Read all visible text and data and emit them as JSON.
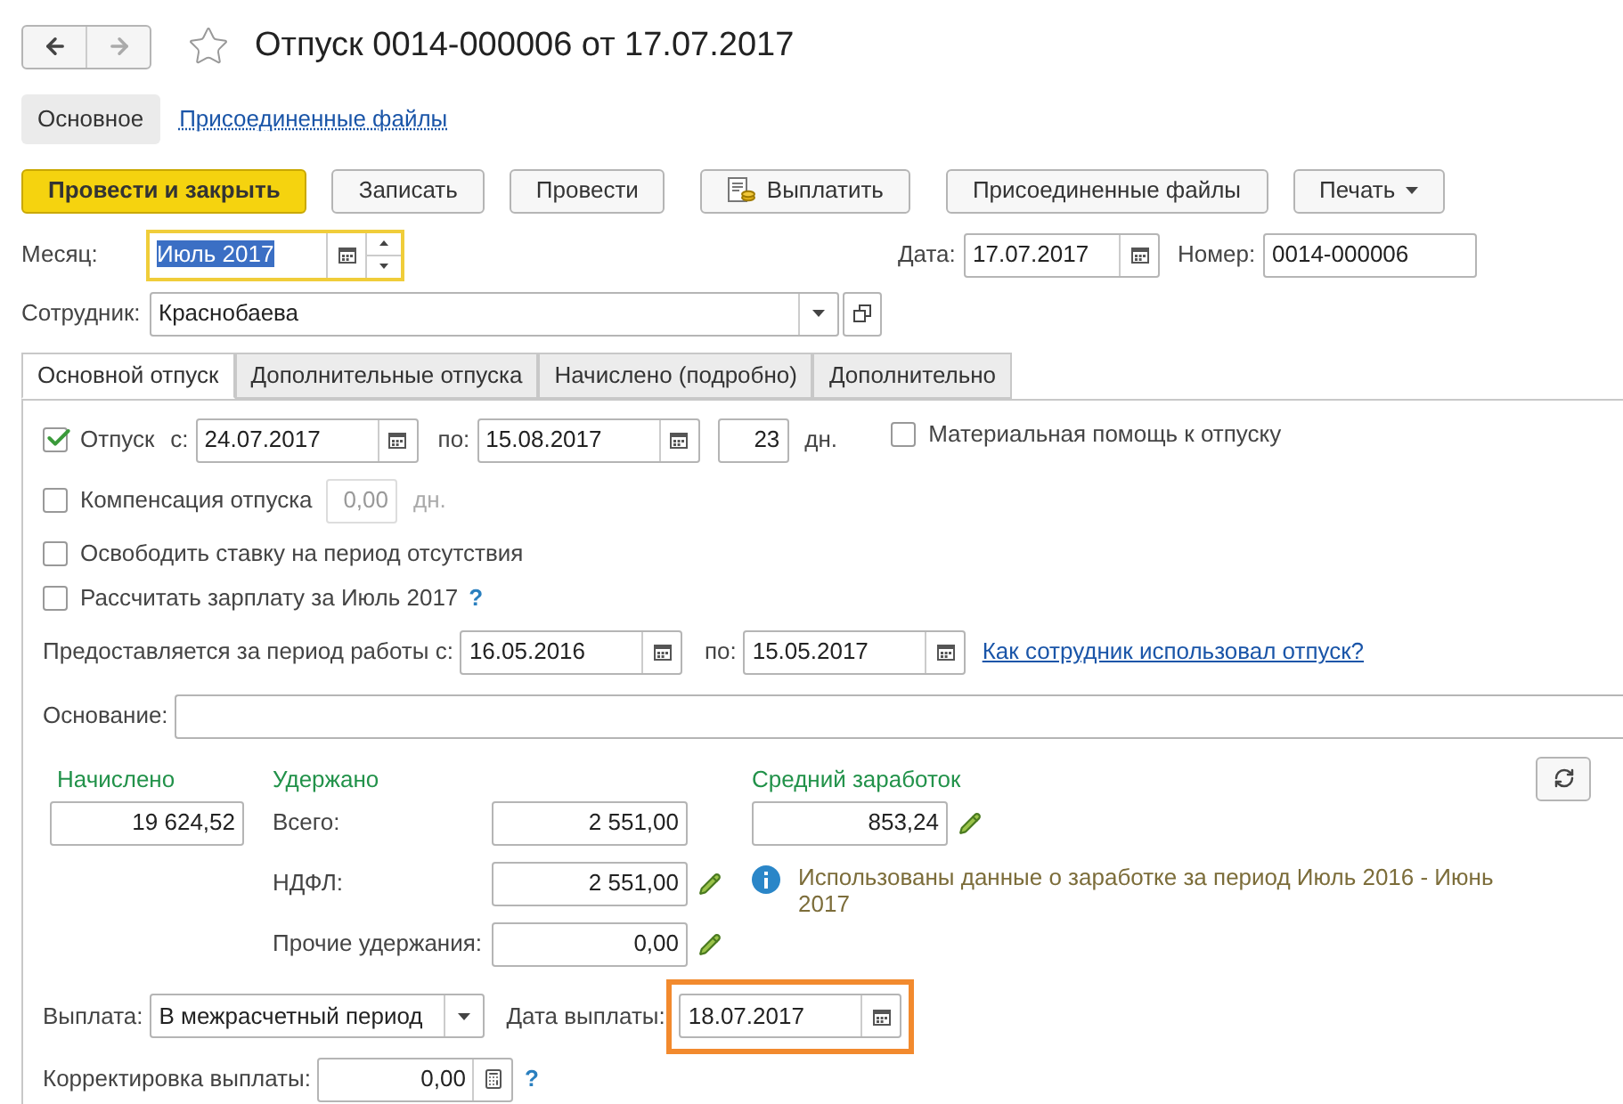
{
  "title": "Отпуск 0014-000006 от 17.07.2017",
  "sections": [
    {
      "label": "Основное",
      "selected": true
    },
    {
      "label": "Присоединенные файлы",
      "selected": false
    }
  ],
  "toolbar": [
    {
      "label": "Провести и закрыть",
      "kind": "primary"
    },
    {
      "label": "Записать",
      "kind": "plain"
    },
    {
      "label": "Провести",
      "kind": "plain"
    },
    {
      "label": "Выплатить",
      "kind": "icon"
    },
    {
      "label": "Присоединенные файлы",
      "kind": "plain"
    },
    {
      "label": "Печать",
      "kind": "menu"
    }
  ],
  "header": {
    "month": {
      "label": "Месяц:",
      "value": "Июль 2017",
      "focused": true
    },
    "date": {
      "label": "Дата:",
      "value": "17.07.2017"
    },
    "number": {
      "label": "Номер:",
      "value": "0014-000006"
    },
    "employee": {
      "label": "Сотрудник:",
      "value": "Краснобаева"
    }
  },
  "tabs": [
    {
      "label": "Основной отпуск",
      "selected": true
    },
    {
      "label": "Дополнительные отпуска",
      "selected": false
    },
    {
      "label": "Начислено (подробно)",
      "selected": false
    },
    {
      "label": "Дополнительно",
      "selected": false
    }
  ],
  "vacation": {
    "checked": true,
    "label": "Отпуск",
    "from_label": "с:",
    "from": "24.07.2017",
    "to_label": "по:",
    "to": "15.08.2017",
    "days": "23",
    "days_unit": "дн."
  },
  "material_aid": {
    "checked": false,
    "label": "Материальная помощь к отпуску"
  },
  "compensation": {
    "checked": false,
    "label": "Компенсация отпуска",
    "value": "0,00",
    "unit": "дн."
  },
  "free_rate": {
    "checked": false,
    "label": "Освободить ставку на период отсутствия"
  },
  "calc_salary": {
    "checked": false,
    "label": "Рассчитать зарплату за Июль 2017",
    "help": "?"
  },
  "work_period": {
    "label": "Предоставляется за период работы с:",
    "from": "16.05.2016",
    "to_label": "по:",
    "to": "15.05.2017",
    "link": "Как сотрудник использовал отпуск?"
  },
  "basis": {
    "label": "Основание:"
  },
  "accrued": {
    "heading": "Начислено",
    "value": "19 624,52"
  },
  "withheld": {
    "heading": "Удержано",
    "rows": [
      {
        "label": "Всего:",
        "value": "2 551,00",
        "editable": false
      },
      {
        "label": "НДФЛ:",
        "value": "2 551,00",
        "editable": true
      },
      {
        "label": "Прочие удержания:",
        "value": "0,00",
        "editable": true
      }
    ]
  },
  "average": {
    "heading": "Средний заработок",
    "value": "853,24",
    "editable": true,
    "note": "Использованы данные о заработке за период Июль 2016 - Июнь 2017"
  },
  "payment": {
    "label": "Выплата:",
    "value": "В межрасчетный период",
    "date_label": "Дата выплаты:",
    "date": "18.07.2017",
    "highlighted": true
  },
  "correction": {
    "label": "Корректировка выплаты:",
    "value": "0,00",
    "help": "?"
  }
}
